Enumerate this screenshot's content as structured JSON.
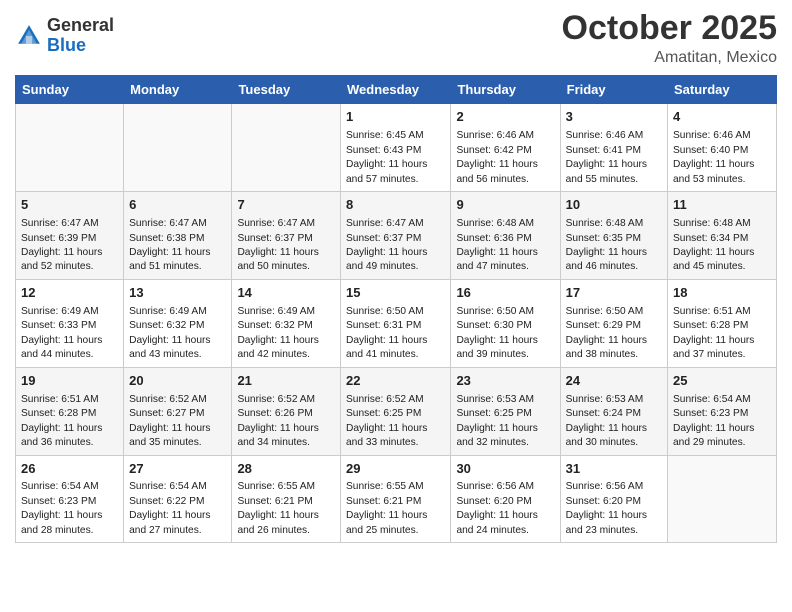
{
  "header": {
    "logo": {
      "general": "General",
      "blue": "Blue"
    },
    "month": "October 2025",
    "location": "Amatitan, Mexico"
  },
  "weekdays": [
    "Sunday",
    "Monday",
    "Tuesday",
    "Wednesday",
    "Thursday",
    "Friday",
    "Saturday"
  ],
  "weeks": [
    [
      {
        "day": "",
        "info": ""
      },
      {
        "day": "",
        "info": ""
      },
      {
        "day": "",
        "info": ""
      },
      {
        "day": "1",
        "info": "Sunrise: 6:45 AM\nSunset: 6:43 PM\nDaylight: 11 hours\nand 57 minutes."
      },
      {
        "day": "2",
        "info": "Sunrise: 6:46 AM\nSunset: 6:42 PM\nDaylight: 11 hours\nand 56 minutes."
      },
      {
        "day": "3",
        "info": "Sunrise: 6:46 AM\nSunset: 6:41 PM\nDaylight: 11 hours\nand 55 minutes."
      },
      {
        "day": "4",
        "info": "Sunrise: 6:46 AM\nSunset: 6:40 PM\nDaylight: 11 hours\nand 53 minutes."
      }
    ],
    [
      {
        "day": "5",
        "info": "Sunrise: 6:47 AM\nSunset: 6:39 PM\nDaylight: 11 hours\nand 52 minutes."
      },
      {
        "day": "6",
        "info": "Sunrise: 6:47 AM\nSunset: 6:38 PM\nDaylight: 11 hours\nand 51 minutes."
      },
      {
        "day": "7",
        "info": "Sunrise: 6:47 AM\nSunset: 6:37 PM\nDaylight: 11 hours\nand 50 minutes."
      },
      {
        "day": "8",
        "info": "Sunrise: 6:47 AM\nSunset: 6:37 PM\nDaylight: 11 hours\nand 49 minutes."
      },
      {
        "day": "9",
        "info": "Sunrise: 6:48 AM\nSunset: 6:36 PM\nDaylight: 11 hours\nand 47 minutes."
      },
      {
        "day": "10",
        "info": "Sunrise: 6:48 AM\nSunset: 6:35 PM\nDaylight: 11 hours\nand 46 minutes."
      },
      {
        "day": "11",
        "info": "Sunrise: 6:48 AM\nSunset: 6:34 PM\nDaylight: 11 hours\nand 45 minutes."
      }
    ],
    [
      {
        "day": "12",
        "info": "Sunrise: 6:49 AM\nSunset: 6:33 PM\nDaylight: 11 hours\nand 44 minutes."
      },
      {
        "day": "13",
        "info": "Sunrise: 6:49 AM\nSunset: 6:32 PM\nDaylight: 11 hours\nand 43 minutes."
      },
      {
        "day": "14",
        "info": "Sunrise: 6:49 AM\nSunset: 6:32 PM\nDaylight: 11 hours\nand 42 minutes."
      },
      {
        "day": "15",
        "info": "Sunrise: 6:50 AM\nSunset: 6:31 PM\nDaylight: 11 hours\nand 41 minutes."
      },
      {
        "day": "16",
        "info": "Sunrise: 6:50 AM\nSunset: 6:30 PM\nDaylight: 11 hours\nand 39 minutes."
      },
      {
        "day": "17",
        "info": "Sunrise: 6:50 AM\nSunset: 6:29 PM\nDaylight: 11 hours\nand 38 minutes."
      },
      {
        "day": "18",
        "info": "Sunrise: 6:51 AM\nSunset: 6:28 PM\nDaylight: 11 hours\nand 37 minutes."
      }
    ],
    [
      {
        "day": "19",
        "info": "Sunrise: 6:51 AM\nSunset: 6:28 PM\nDaylight: 11 hours\nand 36 minutes."
      },
      {
        "day": "20",
        "info": "Sunrise: 6:52 AM\nSunset: 6:27 PM\nDaylight: 11 hours\nand 35 minutes."
      },
      {
        "day": "21",
        "info": "Sunrise: 6:52 AM\nSunset: 6:26 PM\nDaylight: 11 hours\nand 34 minutes."
      },
      {
        "day": "22",
        "info": "Sunrise: 6:52 AM\nSunset: 6:25 PM\nDaylight: 11 hours\nand 33 minutes."
      },
      {
        "day": "23",
        "info": "Sunrise: 6:53 AM\nSunset: 6:25 PM\nDaylight: 11 hours\nand 32 minutes."
      },
      {
        "day": "24",
        "info": "Sunrise: 6:53 AM\nSunset: 6:24 PM\nDaylight: 11 hours\nand 30 minutes."
      },
      {
        "day": "25",
        "info": "Sunrise: 6:54 AM\nSunset: 6:23 PM\nDaylight: 11 hours\nand 29 minutes."
      }
    ],
    [
      {
        "day": "26",
        "info": "Sunrise: 6:54 AM\nSunset: 6:23 PM\nDaylight: 11 hours\nand 28 minutes."
      },
      {
        "day": "27",
        "info": "Sunrise: 6:54 AM\nSunset: 6:22 PM\nDaylight: 11 hours\nand 27 minutes."
      },
      {
        "day": "28",
        "info": "Sunrise: 6:55 AM\nSunset: 6:21 PM\nDaylight: 11 hours\nand 26 minutes."
      },
      {
        "day": "29",
        "info": "Sunrise: 6:55 AM\nSunset: 6:21 PM\nDaylight: 11 hours\nand 25 minutes."
      },
      {
        "day": "30",
        "info": "Sunrise: 6:56 AM\nSunset: 6:20 PM\nDaylight: 11 hours\nand 24 minutes."
      },
      {
        "day": "31",
        "info": "Sunrise: 6:56 AM\nSunset: 6:20 PM\nDaylight: 11 hours\nand 23 minutes."
      },
      {
        "day": "",
        "info": ""
      }
    ]
  ]
}
